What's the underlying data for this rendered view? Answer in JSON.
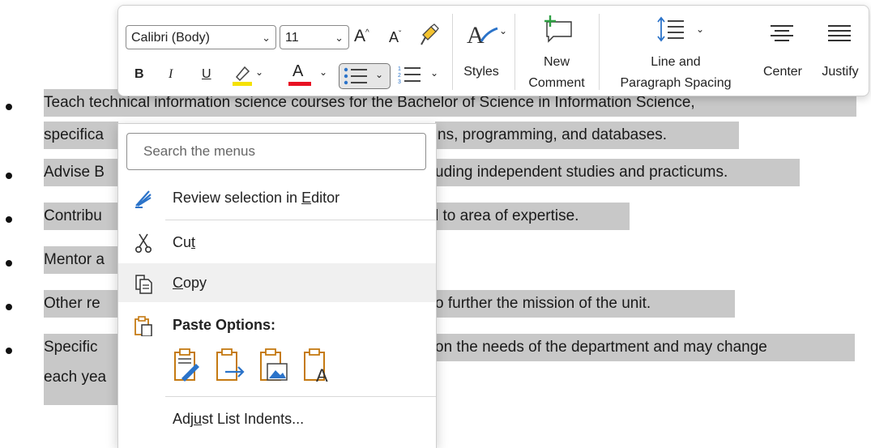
{
  "toolbar": {
    "font_name": "Calibri (Body)",
    "font_size": "11",
    "bold": "B",
    "italic": "I",
    "underline": "U",
    "styles_label": "Styles",
    "new_comment_l1": "New",
    "new_comment_l2": "Comment",
    "line_spacing_l1": "Line and",
    "line_spacing_l2": "Paragraph Spacing",
    "center_label": "Center",
    "justify_label": "Justify",
    "highlight_color": "#f5e100",
    "font_color": "#e81123",
    "accent": "#2b73c9"
  },
  "document": {
    "lines": [
      "Teach technical information science courses for the Bachelor of Science in Information Science,",
      "specifica",
      "ns, programming, and databases.",
      "Advise B",
      "uding independent studies and practicums.",
      "Contribu",
      "l to area of expertise.",
      "Mentor a",
      "Other re",
      "o further the mission of the unit.",
      "Specific",
      "on the needs of the department and may change",
      "each yea"
    ]
  },
  "menu": {
    "search_placeholder": "Search the menus",
    "review_pre": "Review selection in ",
    "review_key": "E",
    "review_post": "ditor",
    "cut_pre": "Cu",
    "cut_key": "t",
    "copy_key": "C",
    "copy_post": "opy",
    "paste_options": "Paste Options:",
    "adjust_pre": "Adj",
    "adjust_key": "u",
    "adjust_post": "st List Indents..."
  }
}
